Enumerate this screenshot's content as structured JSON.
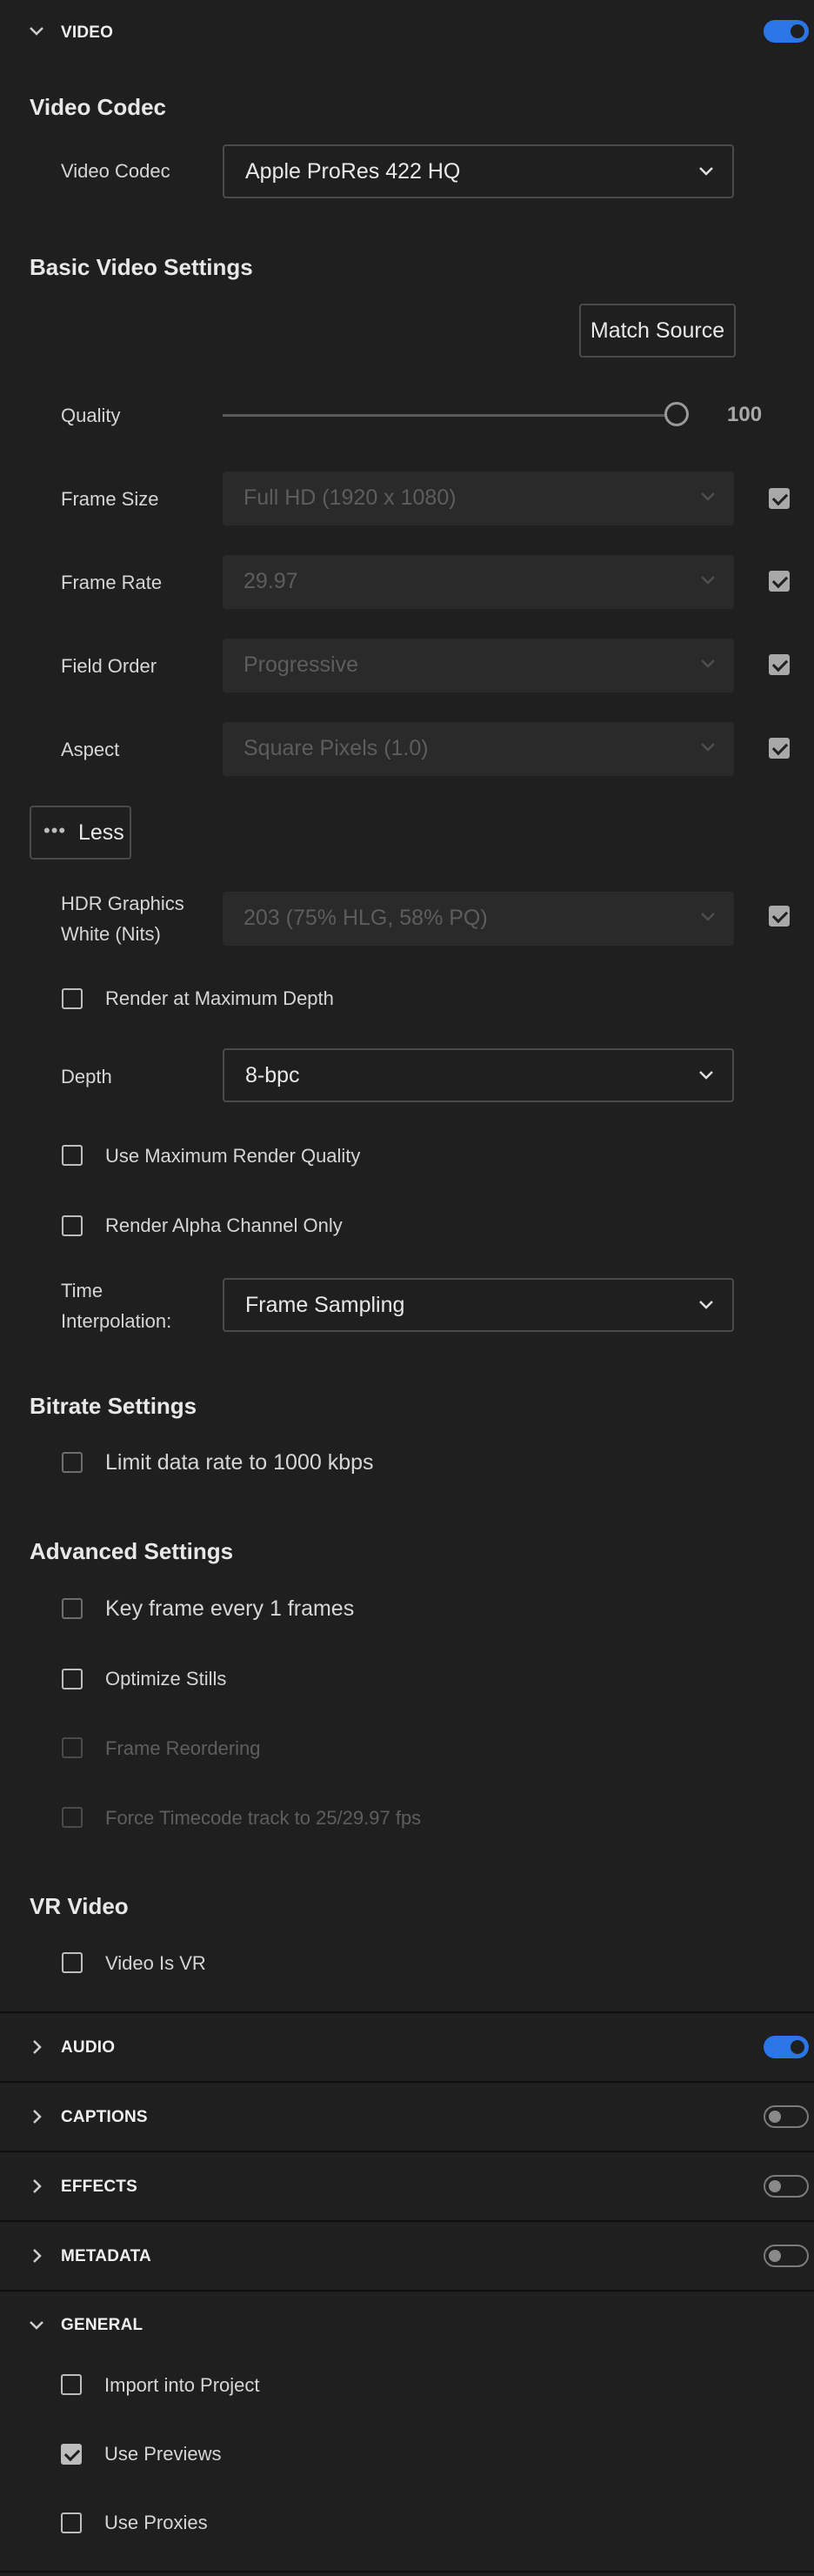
{
  "video": {
    "header": "VIDEO",
    "enabled": true,
    "codec_section": {
      "title": "Video Codec",
      "label": "Video Codec",
      "value": "Apple ProRes 422 HQ"
    },
    "basic": {
      "title": "Basic Video Settings",
      "match_source": "Match Source",
      "quality": {
        "label": "Quality",
        "value": "100",
        "level_percent": 100
      },
      "frame_size": {
        "label": "Frame Size",
        "value": "Full HD (1920 x 1080)"
      },
      "frame_rate": {
        "label": "Frame Rate",
        "value": "29.97"
      },
      "field_order": {
        "label": "Field Order",
        "value": "Progressive"
      },
      "aspect": {
        "label": "Aspect",
        "value": "Square Pixels (1.0)"
      },
      "less_button": "Less",
      "hdr": {
        "label_line1": "HDR Graphics",
        "label_line2": "White (Nits)",
        "value": "203 (75% HLG, 58% PQ)"
      },
      "render_max_depth": "Render at Maximum Depth",
      "depth": {
        "label": "Depth",
        "value": "8-bpc"
      },
      "max_render_quality": "Use Maximum Render Quality",
      "alpha_only": "Render Alpha Channel Only",
      "time_interp": {
        "label_line1": "Time",
        "label_line2": "Interpolation:",
        "value": "Frame Sampling"
      }
    },
    "bitrate": {
      "title": "Bitrate Settings",
      "limit": "Limit data rate to 1000 kbps"
    },
    "advanced": {
      "title": "Advanced Settings",
      "key_frame": "Key frame every 1 frames",
      "optimize_stills": "Optimize Stills",
      "frame_reordering": "Frame Reordering",
      "force_timecode": "Force Timecode track to 25/29.97 fps"
    },
    "vr": {
      "title": "VR Video",
      "is_vr": "Video Is VR"
    }
  },
  "sections": {
    "audio": {
      "label": "AUDIO",
      "enabled": true
    },
    "captions": {
      "label": "CAPTIONS",
      "enabled": false
    },
    "effects": {
      "label": "EFFECTS",
      "enabled": false
    },
    "metadata": {
      "label": "METADATA",
      "enabled": false
    }
  },
  "general": {
    "header": "GENERAL",
    "import_project": "Import into Project",
    "use_previews": "Use Previews",
    "use_proxies": "Use Proxies"
  },
  "colors": {
    "accent": "#2a76e6",
    "background": "#1f1f1f",
    "disabled_field": "#2a2a2a"
  }
}
